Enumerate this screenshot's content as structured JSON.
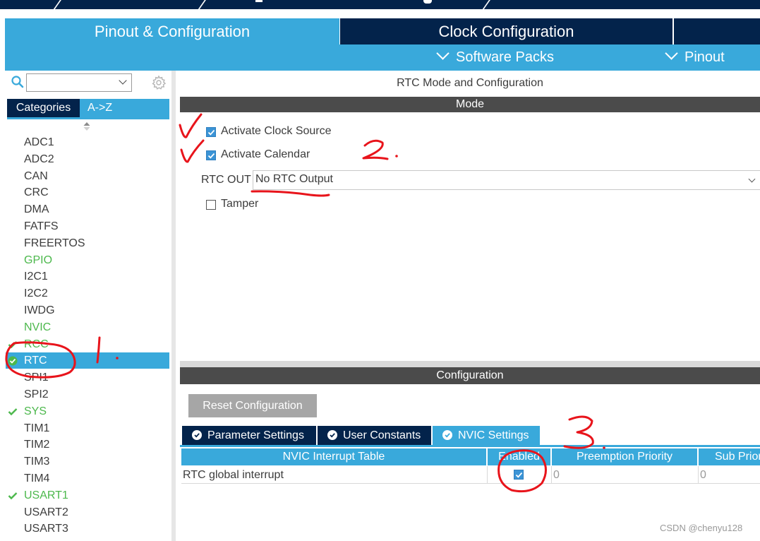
{
  "header": {
    "tabs": [
      {
        "label": "Pinout & Configuration",
        "active": true
      },
      {
        "label": "Clock Configuration",
        "active": false
      }
    ],
    "subbar": {
      "software_packs": "Software Packs",
      "pinout": "Pinout"
    }
  },
  "left_panel": {
    "search": {
      "value": ""
    },
    "view_tabs": [
      "Categories",
      "A->Z"
    ],
    "active_view": "A->Z",
    "categories": [
      {
        "label": "ADC1",
        "green": false,
        "checked": false,
        "selected": false
      },
      {
        "label": "ADC2",
        "green": false,
        "checked": false,
        "selected": false
      },
      {
        "label": "CAN",
        "green": false,
        "checked": false,
        "selected": false
      },
      {
        "label": "CRC",
        "green": false,
        "checked": false,
        "selected": false
      },
      {
        "label": "DMA",
        "green": false,
        "checked": false,
        "selected": false
      },
      {
        "label": "FATFS",
        "green": false,
        "checked": false,
        "selected": false
      },
      {
        "label": "FREERTOS",
        "green": false,
        "checked": false,
        "selected": false
      },
      {
        "label": "GPIO",
        "green": true,
        "checked": false,
        "selected": false
      },
      {
        "label": "I2C1",
        "green": false,
        "checked": false,
        "selected": false
      },
      {
        "label": "I2C2",
        "green": false,
        "checked": false,
        "selected": false
      },
      {
        "label": "IWDG",
        "green": false,
        "checked": false,
        "selected": false
      },
      {
        "label": "NVIC",
        "green": true,
        "checked": false,
        "selected": false
      },
      {
        "label": "RCC",
        "green": true,
        "checked": true,
        "selected": false
      },
      {
        "label": "RTC",
        "green": false,
        "checked": true,
        "selected": true
      },
      {
        "label": "SPI1",
        "green": false,
        "checked": false,
        "selected": false
      },
      {
        "label": "SPI2",
        "green": false,
        "checked": false,
        "selected": false
      },
      {
        "label": "SYS",
        "green": true,
        "checked": true,
        "selected": false
      },
      {
        "label": "TIM1",
        "green": false,
        "checked": false,
        "selected": false
      },
      {
        "label": "TIM2",
        "green": false,
        "checked": false,
        "selected": false
      },
      {
        "label": "TIM3",
        "green": false,
        "checked": false,
        "selected": false
      },
      {
        "label": "TIM4",
        "green": false,
        "checked": false,
        "selected": false
      },
      {
        "label": "USART1",
        "green": true,
        "checked": true,
        "selected": false
      },
      {
        "label": "USART2",
        "green": false,
        "checked": false,
        "selected": false
      },
      {
        "label": "USART3",
        "green": false,
        "checked": false,
        "selected": false
      }
    ]
  },
  "mode": {
    "title": "RTC Mode and Configuration",
    "header": "Mode",
    "activate_clock_source": {
      "label": "Activate Clock Source",
      "checked": true
    },
    "activate_calendar": {
      "label": "Activate Calendar",
      "checked": true
    },
    "rtc_out": {
      "label": "RTC OUT",
      "value": "No RTC Output"
    },
    "tamper": {
      "label": "Tamper",
      "checked": false
    }
  },
  "configuration": {
    "header": "Configuration",
    "reset_label": "Reset Configuration",
    "tabs": [
      {
        "label": "Parameter Settings",
        "active": false
      },
      {
        "label": "User Constants",
        "active": false
      },
      {
        "label": "NVIC Settings",
        "active": true
      }
    ],
    "table": {
      "columns": [
        "NVIC Interrupt Table",
        "Enabled",
        "Preemption Priority",
        "Sub Priority"
      ],
      "rows": [
        {
          "name": "RTC global interrupt",
          "enabled": true,
          "preemption": "0",
          "sub": "0"
        }
      ]
    }
  },
  "annotations": {
    "mark1": "1.",
    "mark2": "2.",
    "mark3": "3."
  },
  "watermark": "CSDN @chenyu128",
  "colors": {
    "accent_blue": "#39a9db",
    "navy": "#03234b",
    "green": "#4cb84c",
    "ink_red": "#e8141b"
  }
}
